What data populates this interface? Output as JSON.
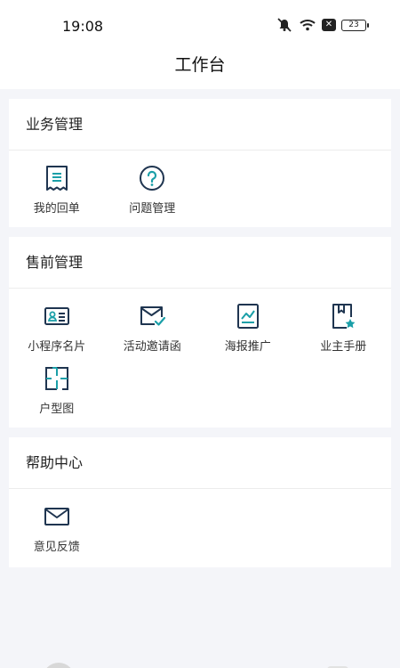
{
  "status_bar": {
    "time": "19:08",
    "battery": "23"
  },
  "header": {
    "title": "工作台"
  },
  "sections": [
    {
      "title": "业务管理",
      "items": [
        {
          "label": "我的回单",
          "icon": "receipt-icon"
        },
        {
          "label": "问题管理",
          "icon": "question-circle-icon"
        }
      ]
    },
    {
      "title": "售前管理",
      "items": [
        {
          "label": "小程序名片",
          "icon": "id-card-icon"
        },
        {
          "label": "活动邀请函",
          "icon": "invitation-envelope-icon"
        },
        {
          "label": "海报推广",
          "icon": "poster-chart-icon"
        },
        {
          "label": "业主手册",
          "icon": "star-bookmark-icon"
        },
        {
          "label": "户型图",
          "icon": "floorplan-icon"
        }
      ]
    },
    {
      "title": "帮助中心",
      "items": [
        {
          "label": "意见反馈",
          "icon": "mail-icon"
        }
      ]
    }
  ],
  "colors": {
    "accent": "#1a9fa8",
    "icon_stroke": "#1f3550",
    "background": "#f4f5f9"
  }
}
